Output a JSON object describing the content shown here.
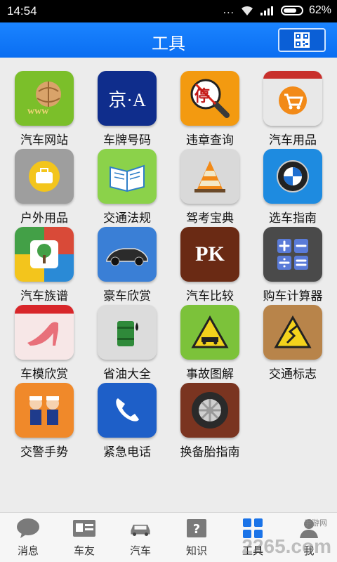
{
  "status_bar": {
    "time": "14:54",
    "signal_dots": "...",
    "battery": "62%"
  },
  "header": {
    "title": "工具",
    "qr_icon": "qr-code-icon"
  },
  "tools": [
    {
      "label": "汽车网站",
      "icon": "globe-www-icon",
      "color": "#7bbf2a"
    },
    {
      "label": "车牌号码",
      "icon": "license-plate-icon",
      "color": "#0f2d8c",
      "text": "京·A"
    },
    {
      "label": "违章查询",
      "icon": "no-parking-magnifier-icon",
      "color": "#f39a10",
      "text": "停"
    },
    {
      "label": "汽车用品",
      "icon": "shopping-cart-icon",
      "color": "#e8e8e8"
    },
    {
      "label": "户外用品",
      "icon": "toolbox-icon",
      "color": "#9e9e9e"
    },
    {
      "label": "交通法规",
      "icon": "open-book-icon",
      "color": "#8bd24a"
    },
    {
      "label": "驾考宝典",
      "icon": "traffic-cone-icon",
      "color": "#d9d9d9"
    },
    {
      "label": "选车指南",
      "icon": "bmw-logo-icon",
      "color": "#1e8be0"
    },
    {
      "label": "汽车族谱",
      "icon": "family-tree-icon",
      "color": "#d94a38"
    },
    {
      "label": "豪车欣赏",
      "icon": "sports-car-icon",
      "color": "#3a7fd6"
    },
    {
      "label": "汽车比较",
      "icon": "pk-icon",
      "color": "#6a2a14",
      "text": "PK"
    },
    {
      "label": "购车计算器",
      "icon": "calculator-icon",
      "color": "#4a4a4a"
    },
    {
      "label": "车模欣赏",
      "icon": "high-heel-icon",
      "color": "#f3c2c2"
    },
    {
      "label": "省油大全",
      "icon": "oil-barrel-icon",
      "color": "#dcdcdc"
    },
    {
      "label": "事故图解",
      "icon": "accident-warning-icon",
      "color": "#7cc23a"
    },
    {
      "label": "交通标志",
      "icon": "winding-road-sign-icon",
      "color": "#b8844a"
    },
    {
      "label": "交警手势",
      "icon": "traffic-police-icon",
      "color": "#f0892a"
    },
    {
      "label": "紧急电话",
      "icon": "phone-icon",
      "color": "#1e5fc8"
    },
    {
      "label": "换备胎指南",
      "icon": "tire-icon",
      "color": "#7a3420"
    }
  ],
  "tabs": [
    {
      "label": "消息",
      "icon": "chat-bubble-icon"
    },
    {
      "label": "车友",
      "icon": "id-card-icon"
    },
    {
      "label": "汽车",
      "icon": "car-icon"
    },
    {
      "label": "知识",
      "icon": "question-book-icon"
    },
    {
      "label": "工具",
      "icon": "grid-tools-icon",
      "active": true
    },
    {
      "label": "我",
      "icon": "person-icon"
    }
  ],
  "watermark": {
    "text": "2265.com",
    "subtext": "手游网"
  }
}
